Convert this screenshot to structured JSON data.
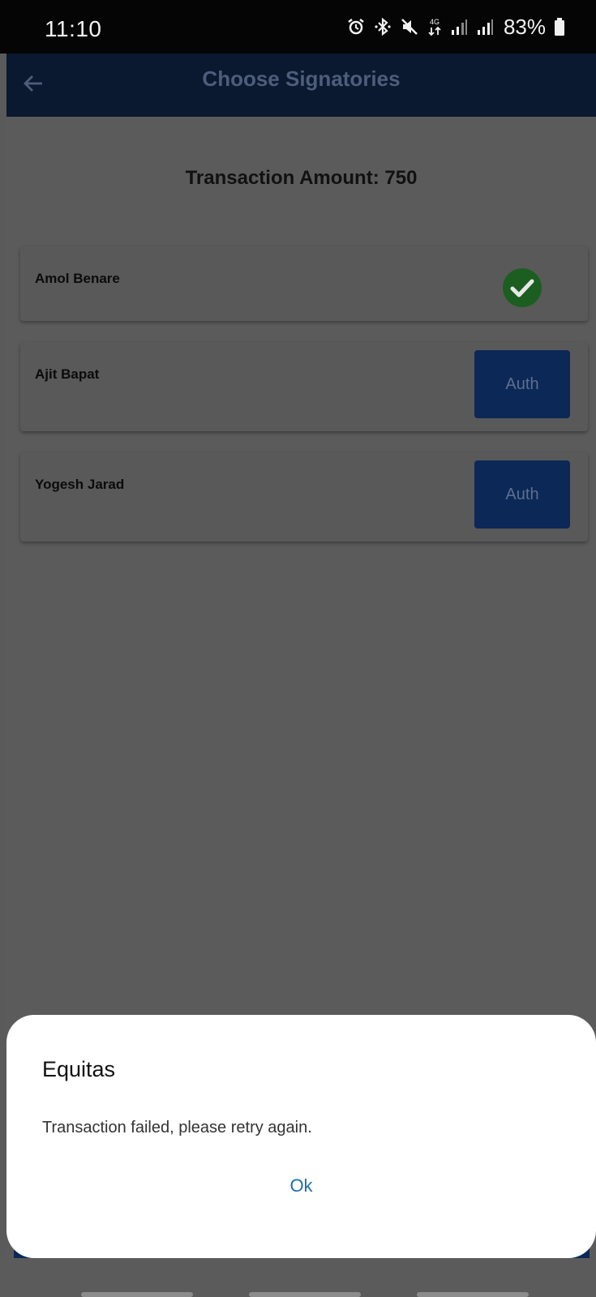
{
  "status_bar": {
    "time": "11:10",
    "network": "4G",
    "battery": "83%",
    "icons": [
      "alarm-icon",
      "bluetooth-icon",
      "mute-icon",
      "data-icon",
      "signal-icon",
      "signal-icon",
      "battery-icon"
    ]
  },
  "app_bar": {
    "title": "Choose Signatories",
    "back_icon": "back-arrow-icon",
    "color": "#0a1830"
  },
  "transaction": {
    "amount_label": "Transaction Amount: 750"
  },
  "signatories": [
    {
      "name": "Amol Benare",
      "status": "authorized",
      "icon": "check-circle-icon"
    },
    {
      "name": "Ajit Bapat",
      "status": "pending",
      "button_label": "Auth"
    },
    {
      "name": "Yogesh Jarad",
      "status": "pending",
      "button_label": "Auth"
    }
  ],
  "dialog": {
    "title": "Equitas",
    "message": "Transaction failed, please retry again.",
    "ok_label": "Ok",
    "ok_color": "#1f6fa8"
  },
  "colors": {
    "scrim": "#5a5a5a",
    "auth_button": "#0b2856",
    "success": "#1b5e20"
  }
}
